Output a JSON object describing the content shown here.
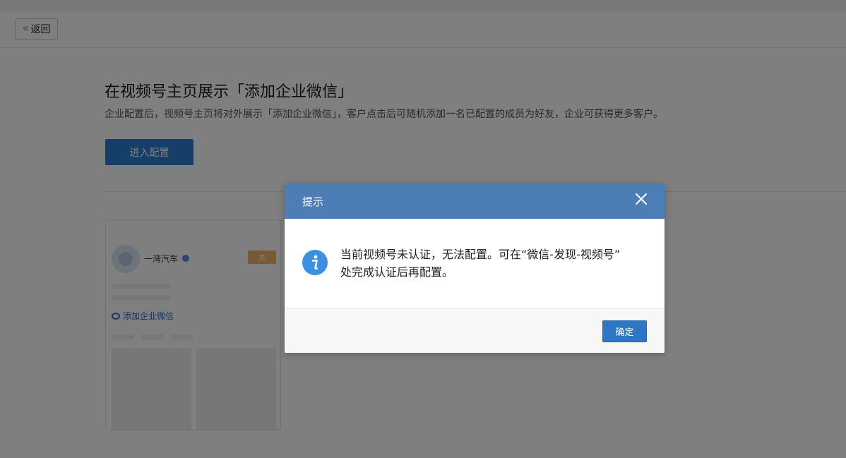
{
  "toolbar": {
    "back_label": "返回"
  },
  "page": {
    "title": "在视频号主页展示「添加企业微信」",
    "description": "企业配置后，视频号主页将对外展示「添加企业微信」，客户点击后可随机添加一名已配置的成员为好友，企业可获得更多客户。",
    "config_button": "进入配置"
  },
  "preview": {
    "account_name": "一湾汽车",
    "follow_label": "关",
    "add_wecom_link": "添加企业微信"
  },
  "dialog": {
    "title": "提示",
    "message_line1": "当前视频号未认证，无法配置。可在“微信-发现-视频号”",
    "message_line2": "处完成认证后再配置。",
    "ok_label": "确定"
  },
  "colors": {
    "dialog_header": "#4c7db5",
    "primary_button": "#2b7cd3",
    "info_icon": "#3d8fe0"
  }
}
